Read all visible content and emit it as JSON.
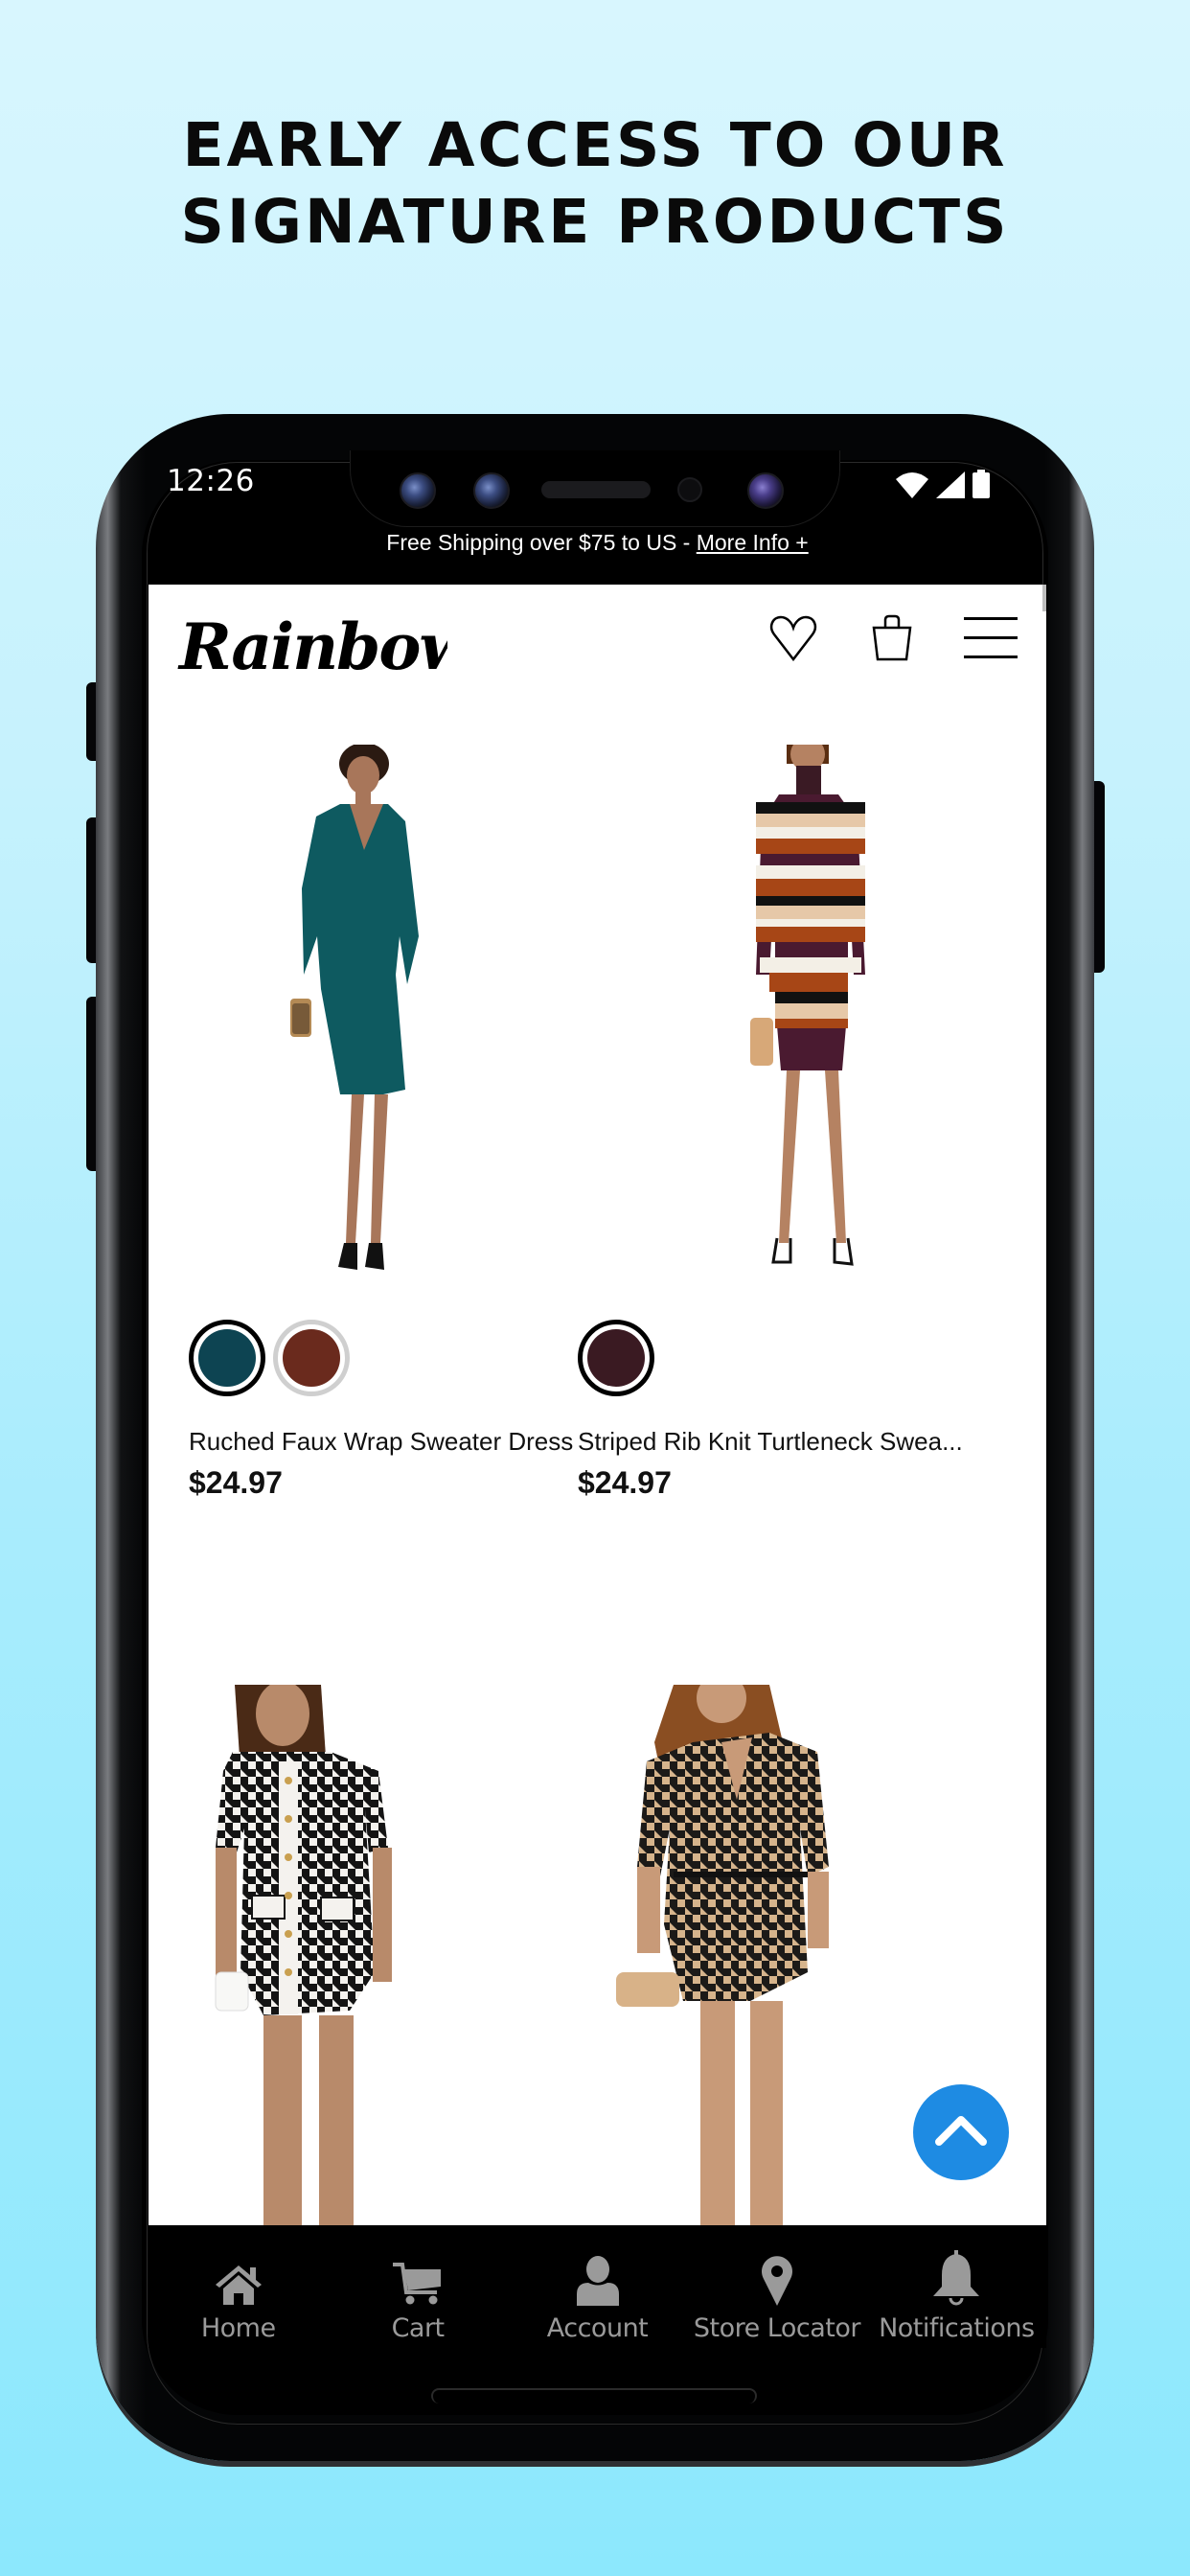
{
  "headline": {
    "line1": "EARLY ACCESS TO OUR",
    "line2": "SIGNATURE PRODUCTS"
  },
  "status_bar": {
    "time": "12:26",
    "icons": [
      "wifi-icon",
      "signal-icon",
      "battery-icon"
    ]
  },
  "shipping_banner": {
    "text": "Free Shipping over $75 to US - ",
    "link": "More Info +"
  },
  "header": {
    "logo": "Rainbow",
    "icons": [
      "heart-icon",
      "shopping-bag-icon",
      "menu-icon"
    ]
  },
  "products": [
    {
      "name": "Ruched Faux Wrap Sweater Dress",
      "price": "$24.97",
      "swatches": [
        {
          "color": "#0d4452",
          "selected": true
        },
        {
          "color": "#6a2a1d",
          "selected": false
        }
      ],
      "image": "teal wrap sweater dress"
    },
    {
      "name": "Striped Rib Knit Turtleneck Swea...",
      "price": "$24.97",
      "swatches": [
        {
          "color": "#3a1a22",
          "selected": true
        }
      ],
      "image": "striped turtleneck dress"
    },
    {
      "image": "black and white houndstooth dress"
    },
    {
      "image": "tan houndstooth shirt dress"
    }
  ],
  "scroll_to_top": {
    "icon": "chevron-up-icon",
    "color": "#1e8be3"
  },
  "bottom_nav": [
    {
      "label": "Home",
      "icon": "home-icon"
    },
    {
      "label": "Cart",
      "icon": "cart-icon"
    },
    {
      "label": "Account",
      "icon": "account-icon"
    },
    {
      "label": "Store Locator",
      "icon": "location-pin-icon"
    },
    {
      "label": "Notifications",
      "icon": "bell-icon"
    }
  ]
}
